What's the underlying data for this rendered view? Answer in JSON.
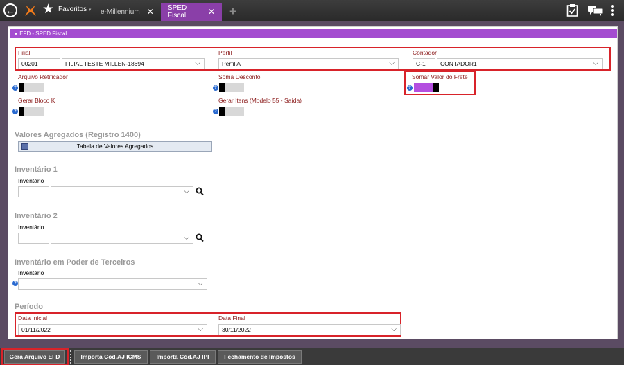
{
  "topbar": {
    "favorites_label": "Favoritos",
    "favorites_caret": "▾",
    "tabs": [
      {
        "label": "e-Millennium",
        "close": "✕"
      },
      {
        "label": "SPED Fiscal",
        "close": "✕"
      }
    ],
    "add_tab": "+",
    "icons": [
      "back-arrow-icon",
      "millennium-logo-icon",
      "star-icon",
      "clipboard-check-icon",
      "chat-icon",
      "more-vert-icon"
    ]
  },
  "panel": {
    "title": "EFD - SPED Fiscal",
    "collapse_icon": "▼"
  },
  "form": {
    "filial": {
      "label": "Filial",
      "code": "00201",
      "name": "FILIAL TESTE MILLEN-18694"
    },
    "perfil": {
      "label": "Perfil",
      "value": "Perfil A"
    },
    "contador": {
      "label": "Contador",
      "code": "C-1",
      "name": "CONTADOR1"
    },
    "arquivo_retificador": {
      "label": "Arquivo Retificador",
      "on": false
    },
    "soma_desconto": {
      "label": "Soma Desconto",
      "on": false
    },
    "somar_valor_frete": {
      "label": "Somar Valor do Frete",
      "on": true
    },
    "gerar_bloco_k": {
      "label": "Gerar Bloco K",
      "on": false
    },
    "gerar_itens": {
      "label": "Gerar Itens (Modelo 55 - Saída)",
      "on": false
    },
    "help_glyph": "?"
  },
  "sections": {
    "valores_agregados": {
      "title": "Valores Agregados (Registro 1400)",
      "button": "Tabela de Valores Agregados"
    },
    "inventario1": {
      "title": "Inventário 1",
      "field_label": "Inventário"
    },
    "inventario2": {
      "title": "Inventário 2",
      "field_label": "Inventário"
    },
    "inventario_terceiros": {
      "title": "Inventário em Poder de Terceiros",
      "field_label": "Inventário"
    },
    "periodo": {
      "title": "Período",
      "data_inicial": {
        "label": "Data Inicial",
        "value": "01/11/2022"
      },
      "data_final": {
        "label": "Data Final",
        "value": "30/11/2022"
      }
    }
  },
  "bottom_buttons": [
    "Gera Arquivo EFD",
    "Importa Cód.AJ ICMS",
    "Importa Cód.AJ IPI",
    "Fechamento de Impostos"
  ],
  "colors": {
    "accent": "#a44cd0",
    "highlight_border": "#d8232a",
    "label": "#8b1a1a"
  }
}
